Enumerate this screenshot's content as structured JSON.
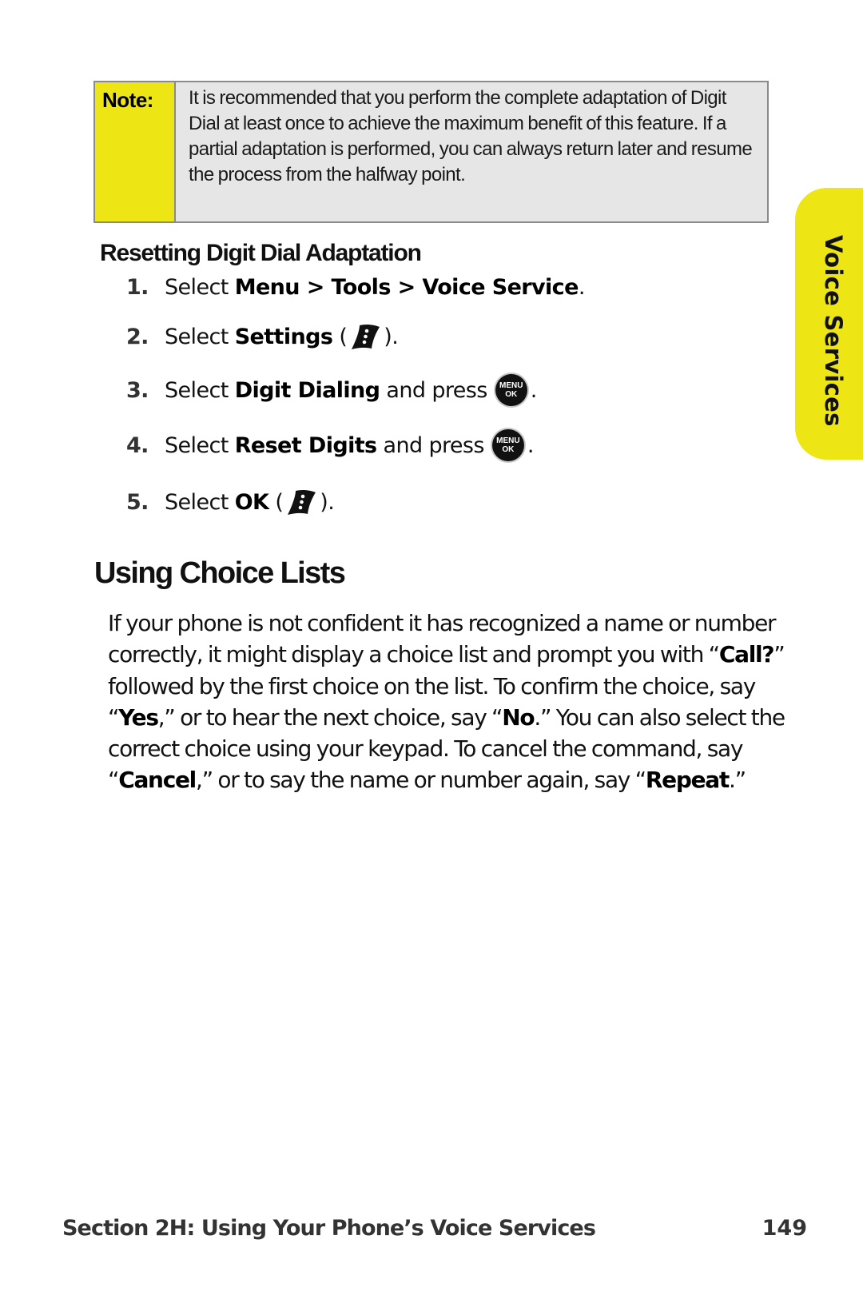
{
  "note": {
    "label": "Note:",
    "text": "It is recommended that you perform the complete adaptation of Digit Dial at least once to achieve the maximum benefit of this feature. If a partial adaptation is performed, you can always return later and resume the process from the halfway point."
  },
  "side_tab": {
    "label": "Voice Services",
    "color": "#eee614"
  },
  "section": {
    "title": "Resetting Digit Dial Adaptation",
    "steps": [
      {
        "num": "1.",
        "pre": "Select ",
        "bold": "Menu > Tools > Voice Service",
        "post": "."
      },
      {
        "num": "2.",
        "pre": "Select ",
        "bold": "Settings",
        "post_open": " (",
        "icon": "right-softkey-icon",
        "post": ")."
      },
      {
        "num": "3.",
        "pre": "Select ",
        "bold": "Digit Dialing",
        "post": " and press",
        "icon": "menu-ok-button-icon",
        "end": "."
      },
      {
        "num": "4.",
        "pre": "Select ",
        "bold": "Reset Digits",
        "post": " and press",
        "icon": "menu-ok-button-icon",
        "end": "."
      },
      {
        "num": "5.",
        "pre": "Select ",
        "bold": "OK",
        "post_open": " (",
        "icon": "right-softkey-icon",
        "post": ")."
      }
    ],
    "menu_ok": {
      "top": "MENU",
      "bottom": "OK"
    }
  },
  "choice_lists": {
    "title": "Using Choice Lists",
    "paragraph": [
      {
        "t": "If your phone is not confident it has recognized a name or number correctly, it might display a choice list and prompt you with “"
      },
      {
        "b": "Call?"
      },
      {
        "t": "” followed by the first choice on the list. To confirm the choice, say “"
      },
      {
        "b": "Yes"
      },
      {
        "t": ",” or to hear the next choice, say “"
      },
      {
        "b": "No"
      },
      {
        "t": ".” You can also select the correct choice using your keypad. To cancel the command, say “"
      },
      {
        "b": "Cancel"
      },
      {
        "t": ",” or to say the name or number again, say “"
      },
      {
        "b": "Repeat"
      },
      {
        "t": ".”"
      }
    ]
  },
  "footer": {
    "section_label": "Section 2H: Using Your Phone’s Voice Services",
    "page_number": "149"
  }
}
